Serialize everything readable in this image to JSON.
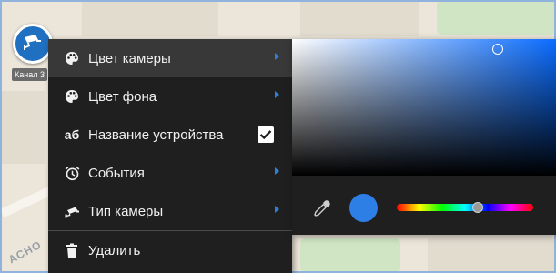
{
  "camera": {
    "label": "Канал 3",
    "icon": "cctv-camera-icon"
  },
  "map": {
    "street_label": "АСНО"
  },
  "menu": {
    "items": [
      {
        "label": "Цвет камеры",
        "icon": "palette-icon",
        "has_submenu": true,
        "active": true
      },
      {
        "label": "Цвет фона",
        "icon": "palette-icon",
        "has_submenu": true
      },
      {
        "label": "Название устройства",
        "icon_text": "аб",
        "checked": true
      },
      {
        "label": "События",
        "icon": "alarm-clock-icon",
        "has_submenu": true
      },
      {
        "label": "Тип камеры",
        "icon": "camera-type-icon",
        "has_submenu": true
      },
      {
        "label": "Удалить",
        "icon": "trash-icon"
      }
    ]
  },
  "color_picker": {
    "selected_color": "#2d7fe6",
    "hue_position": 0.59,
    "saturation_hue_color": "#0a6cff",
    "eyedropper_icon": "eyedropper-icon"
  },
  "colors": {
    "menu_bg": "#1f1f1f",
    "accent": "#2d7fd8",
    "marker": "#1f70c1"
  }
}
